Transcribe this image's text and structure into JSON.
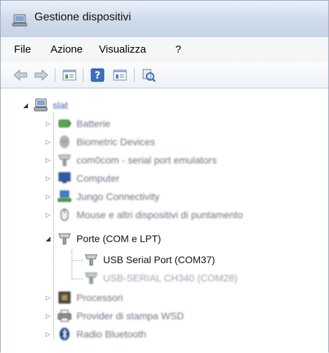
{
  "window": {
    "title": "Gestione dispositivi"
  },
  "menu": [
    {
      "label": "File"
    },
    {
      "label": "Azione"
    },
    {
      "label": "Visualizza"
    },
    {
      "label": "?"
    }
  ],
  "toolbar": {
    "buttons": [
      {
        "icon": "back-arrow-icon"
      },
      {
        "icon": "forward-arrow-icon"
      },
      {
        "icon": "properties-icon"
      },
      {
        "icon": "help-icon"
      },
      {
        "icon": "update-driver-icon"
      },
      {
        "icon": "scan-hardware-icon"
      }
    ]
  },
  "tree": {
    "root": {
      "label": "slat",
      "icon": "computer-icon"
    },
    "items": [
      {
        "label": "Batterie",
        "icon": "battery-icon"
      },
      {
        "label": "Biometric Devices",
        "icon": "fingerprint-icon"
      },
      {
        "label": "com0com - serial port emulators",
        "icon": "port-icon"
      },
      {
        "label": "Computer",
        "icon": "monitor-icon"
      },
      {
        "label": "Jungo Connectivity",
        "icon": "network-icon"
      },
      {
        "label": "Mouse e altri dispositivi di puntamento",
        "icon": "mouse-icon"
      },
      {
        "label": "Porte (COM e LPT)",
        "icon": "port-icon",
        "children": [
          {
            "label": "USB Serial Port (COM37)",
            "icon": "port-icon"
          },
          {
            "label": "USB-SERIAL CH340 (COM28)",
            "icon": "port-icon"
          }
        ]
      },
      {
        "label": "Processori",
        "icon": "processor-icon"
      },
      {
        "label": "Provider di stampa WSD",
        "icon": "printer-icon"
      },
      {
        "label": "Radio Bluetooth",
        "icon": "bluetooth-icon"
      }
    ]
  }
}
